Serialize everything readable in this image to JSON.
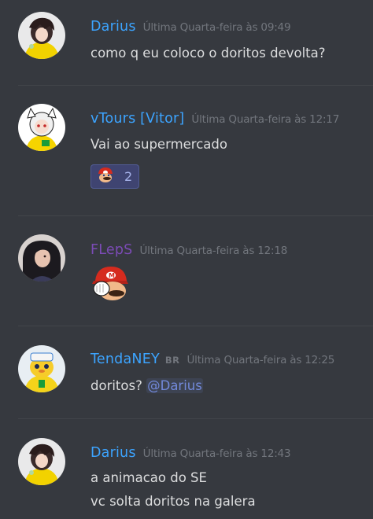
{
  "colors": {
    "background": "#36393f",
    "author_blue": "#3ca4ff",
    "author_purple": "#7b4bb5",
    "timestamp": "#72767d",
    "text": "#dcddde",
    "mention": "#7289da"
  },
  "messages": [
    {
      "author": "Darius",
      "timestamp": "Última Quarta-feira às 09:49",
      "lines": [
        "como q eu coloco o doritos devolta?"
      ]
    },
    {
      "author": "vTours [Vitor]",
      "timestamp": "Última Quarta-feira às 12:17",
      "lines": [
        "Vai ao supermercado"
      ],
      "reaction": {
        "emoji": "mario-face-icon",
        "count": "2"
      }
    },
    {
      "author": "FLepS",
      "timestamp": "Última Quarta-feira às 12:18",
      "emoji": "mario-facepalm-icon"
    },
    {
      "author": "TendaNEY",
      "tag": "BR",
      "timestamp": "Última Quarta-feira às 12:25",
      "text": "doritos?",
      "mention": "@Darius"
    },
    {
      "author": "Darius",
      "timestamp": "Última Quarta-feira às 12:43",
      "lines": [
        "a animacao do SE",
        "vc solta doritos na galera"
      ]
    }
  ]
}
